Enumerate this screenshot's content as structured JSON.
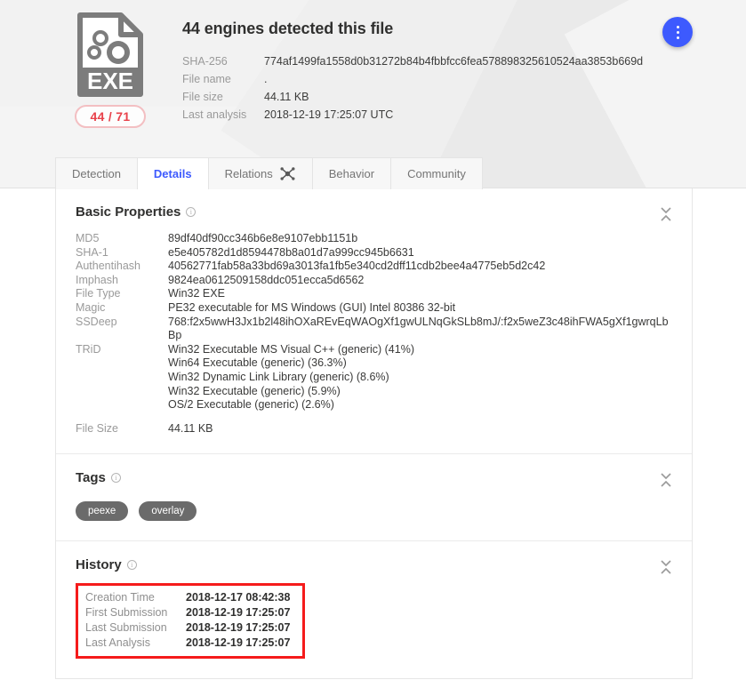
{
  "header": {
    "headline": "44 engines detected this file",
    "detection_badge": "44 / 71",
    "file_icon_label": "EXE",
    "meta": [
      {
        "key": "SHA-256",
        "value": "774af1499fa1558d0b31272b84b4fbbfcc6fea578898325610524aa3853b669d"
      },
      {
        "key": "File name",
        "value": "."
      },
      {
        "key": "File size",
        "value": "44.11 KB"
      },
      {
        "key": "Last analysis",
        "value": "2018-12-19 17:25:07 UTC"
      }
    ],
    "more_actions_label": "More actions"
  },
  "tabs": [
    {
      "label": "Detection",
      "active": false,
      "icon": null
    },
    {
      "label": "Details",
      "active": true,
      "icon": null
    },
    {
      "label": "Relations",
      "active": false,
      "icon": "network-graph-icon"
    },
    {
      "label": "Behavior",
      "active": false,
      "icon": null
    },
    {
      "label": "Community",
      "active": false,
      "icon": null
    }
  ],
  "basic_properties": {
    "title": "Basic Properties",
    "rows": [
      {
        "key": "MD5",
        "value": "89df40df90cc346b6e8e9107ebb1151b"
      },
      {
        "key": "SHA-1",
        "value": "e5e405782d1d8594478b8a01d7a999cc945b6631"
      },
      {
        "key": "Authentihash",
        "value": "40562771fab58a33bd69a3013fa1fb5e340cd2dff11cdb2bee4a4775eb5d2c42"
      },
      {
        "key": "Imphash",
        "value": "9824ea0612509158ddc051ecca5d6562"
      },
      {
        "key": "File Type",
        "value": "Win32 EXE"
      },
      {
        "key": "Magic",
        "value": "PE32 executable for MS Windows (GUI) Intel 80386 32-bit"
      },
      {
        "key": "SSDeep",
        "value": "768:f2x5wwH3Jx1b2l48ihOXaREvEqWAOgXf1gwULNqGkSLb8mJ/:f2x5weZ3c48ihFWA5gXf1gwrqLbBp"
      }
    ],
    "trid_key": "TRiD",
    "trid": [
      "Win32 Executable MS Visual C++ (generic) (41%)",
      "Win64 Executable (generic) (36.3%)",
      "Win32 Dynamic Link Library (generic) (8.6%)",
      "Win32 Executable (generic) (5.9%)",
      "OS/2 Executable (generic) (2.6%)"
    ],
    "file_size_key": "File Size",
    "file_size_value": "44.11 KB"
  },
  "tags_section": {
    "title": "Tags",
    "tags": [
      "peexe",
      "overlay"
    ]
  },
  "history_section": {
    "title": "History",
    "rows": [
      {
        "key": "Creation Time",
        "value": "2018-12-17 08:42:38"
      },
      {
        "key": "First Submission",
        "value": "2018-12-19 17:25:07"
      },
      {
        "key": "Last Submission",
        "value": "2018-12-19 17:25:07"
      },
      {
        "key": "Last Analysis",
        "value": "2018-12-19 17:25:07"
      }
    ]
  },
  "colors": {
    "accent_blue": "#3d5afe",
    "detection_red": "#e8414a",
    "annotation_red": "#f51b1b",
    "tag_gray": "#6b6b6b",
    "header_bg": "#f2f2f2"
  }
}
